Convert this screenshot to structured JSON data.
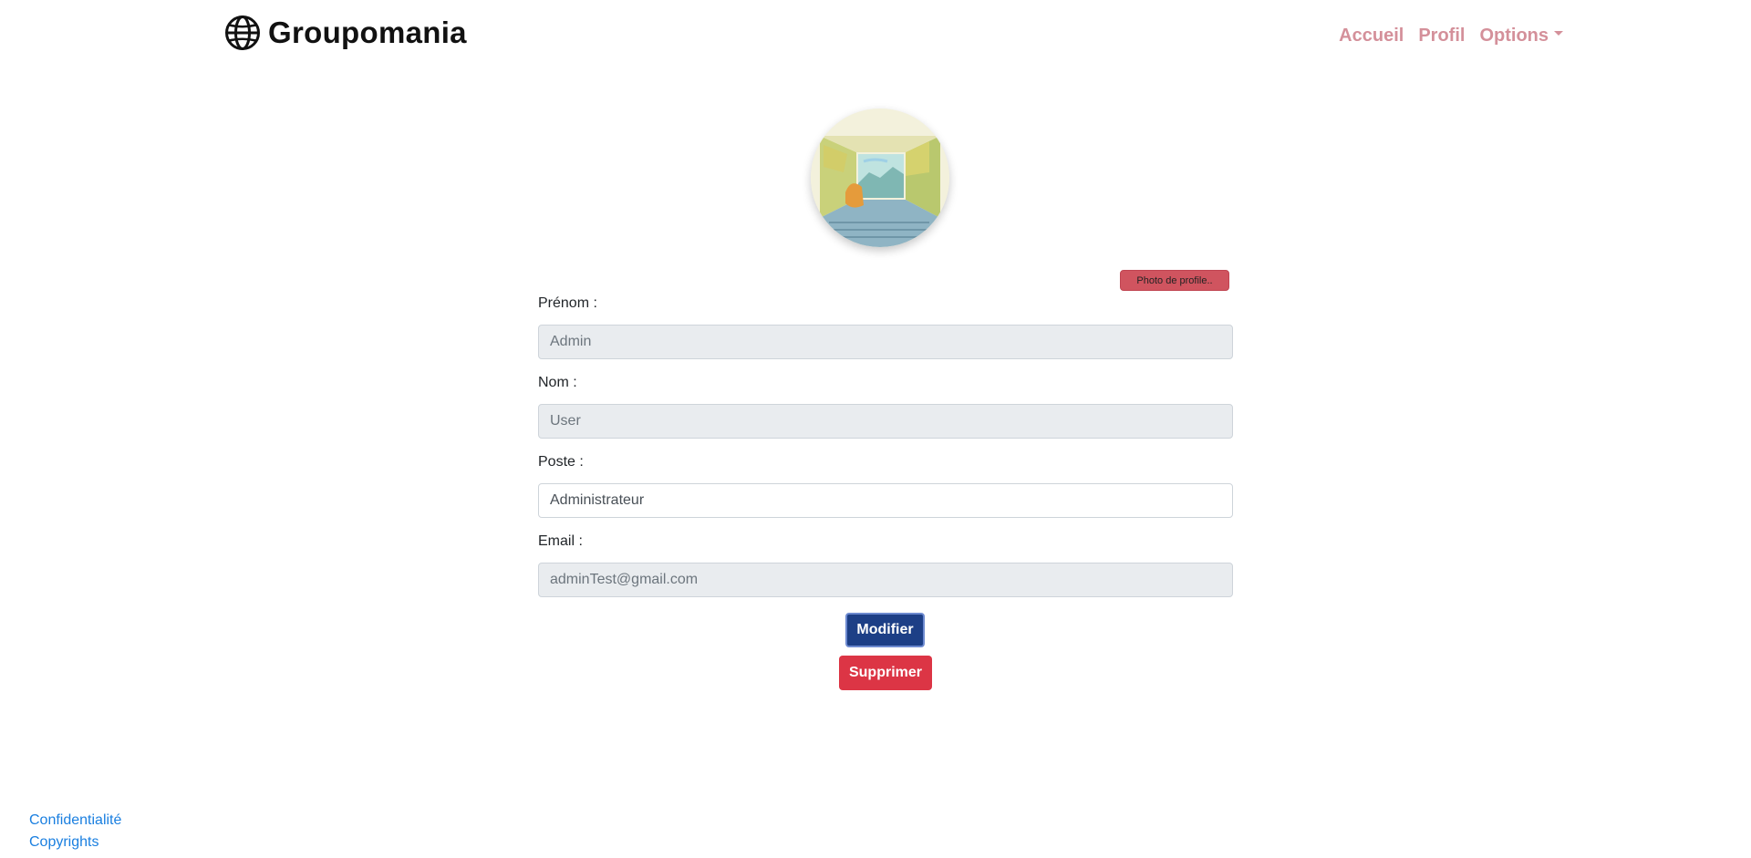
{
  "header": {
    "brand_name": "Groupomania",
    "brand_icon": "globe-icon",
    "nav": {
      "home": "Accueil",
      "profile": "Profil",
      "options": "Options"
    },
    "nav_color": "#d4909a"
  },
  "profile": {
    "avatar_alt": "profile-picture",
    "photo_button": "Photo de profile..",
    "fields": {
      "first_name": {
        "label": "Prénom :",
        "value": "Admin"
      },
      "last_name": {
        "label": "Nom :",
        "value": "User"
      },
      "position": {
        "label": "Poste :",
        "value": "Administrateur"
      },
      "email": {
        "label": "Email :",
        "value": "adminTest@gmail.com"
      }
    },
    "buttons": {
      "modify": "Modifier",
      "delete": "Supprimer"
    }
  },
  "footer": {
    "privacy": "Confidentialité",
    "copyrights": "Copyrights"
  },
  "colors": {
    "modify_button": "#1d3f86",
    "delete_button": "#dc3545",
    "photo_button": "#d0545f",
    "footer_link": "#1a7fe0"
  }
}
